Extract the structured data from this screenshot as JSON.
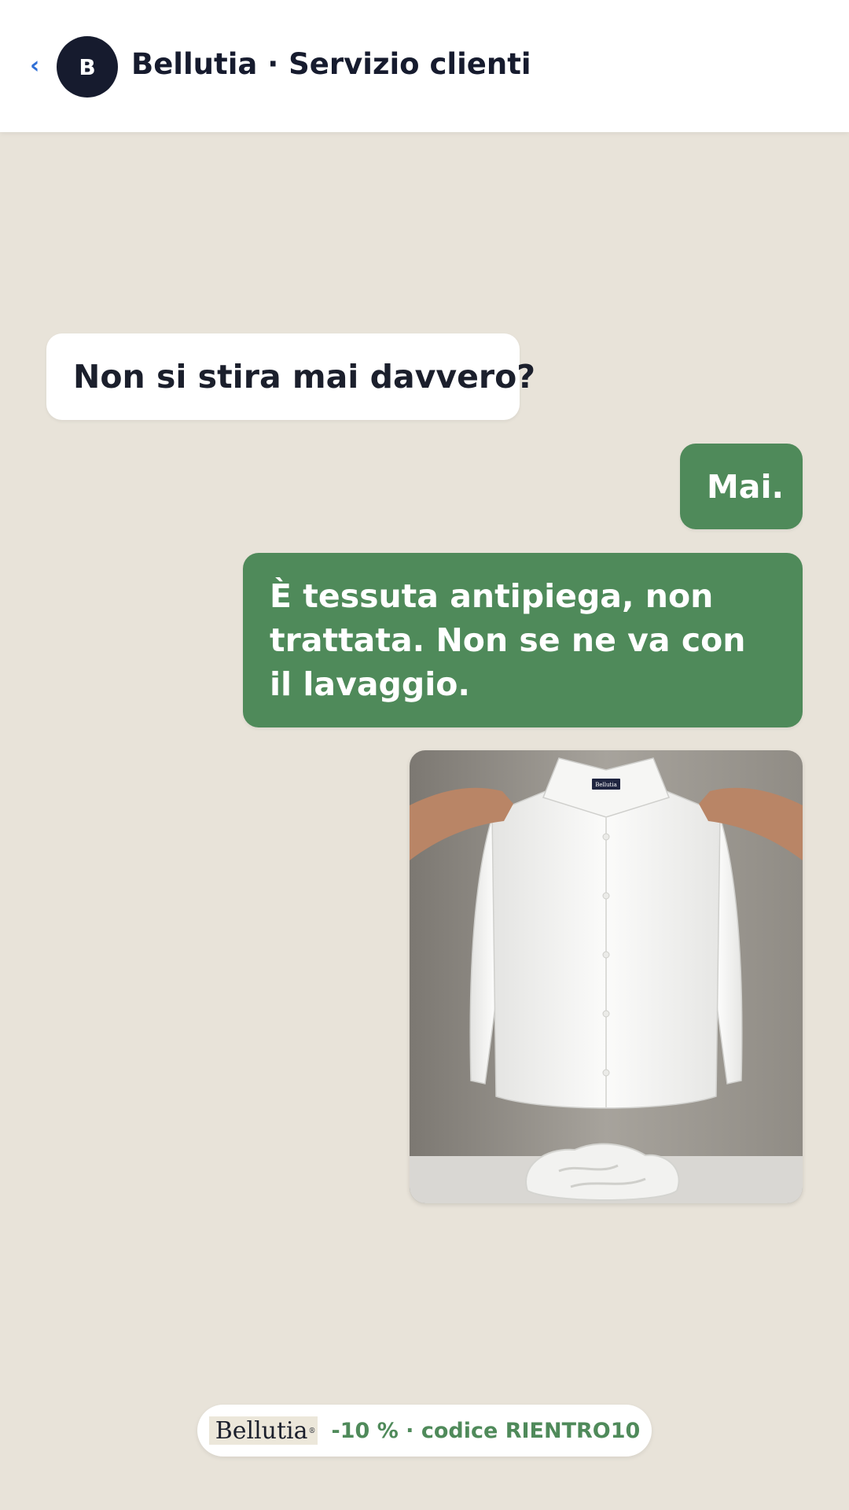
{
  "header": {
    "back_icon": "chevron-left-icon",
    "avatar_letter": "B",
    "title": "Bellutia · Servizio clienti"
  },
  "messages": [
    {
      "direction": "incoming",
      "text": "Non si stira mai davvero?"
    },
    {
      "direction": "outgoing",
      "text": "Mai."
    },
    {
      "direction": "outgoing",
      "text": "È tessuta antipiega, non trattata. Non se ne va con il lavaggio."
    }
  ],
  "photo": {
    "shirt_label": "Bellutia"
  },
  "promo": {
    "logo_text": "Bellutia",
    "logo_mark": "®",
    "text": "-10 % · codice RIENTRO10"
  },
  "colors": {
    "background": "#e8e3d9",
    "outgoing_bubble": "#4f8a5a",
    "incoming_bubble": "#ffffff",
    "accent_link": "#2f6fd6",
    "avatar": "#161b2e"
  }
}
